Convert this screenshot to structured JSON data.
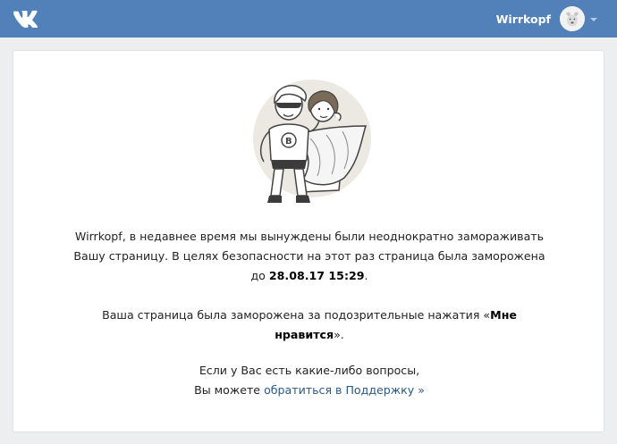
{
  "header": {
    "logo_icon": "vk-logo-icon",
    "user_name": "Wirrkopf",
    "avatar_icon": "dog-avatar-icon",
    "menu_icon": "chevron-down-icon"
  },
  "illustration_icon": "superhero-couple-illustration",
  "message": {
    "p1_text": "Wirrkopf, в недавнее время мы вынуждены были неоднократно замораживать Вашу страницу. В целях безопасности на этот раз страница была заморожена до ",
    "p1_date": "28.08.17 15:29",
    "p1_end": ".",
    "p2_text": "Ваша страница была заморожена за подозрительные нажатия «",
    "p2_bold": "Мне нравится",
    "p2_end": "».",
    "p3_line1": "Если у Вас есть какие-либо вопросы,",
    "p3_line2": "Вы можете ",
    "support_link": "обратиться в Поддержку »"
  },
  "colors": {
    "header_bg": "#5181b8",
    "page_bg": "#edeef0",
    "link": "#2a5885"
  }
}
